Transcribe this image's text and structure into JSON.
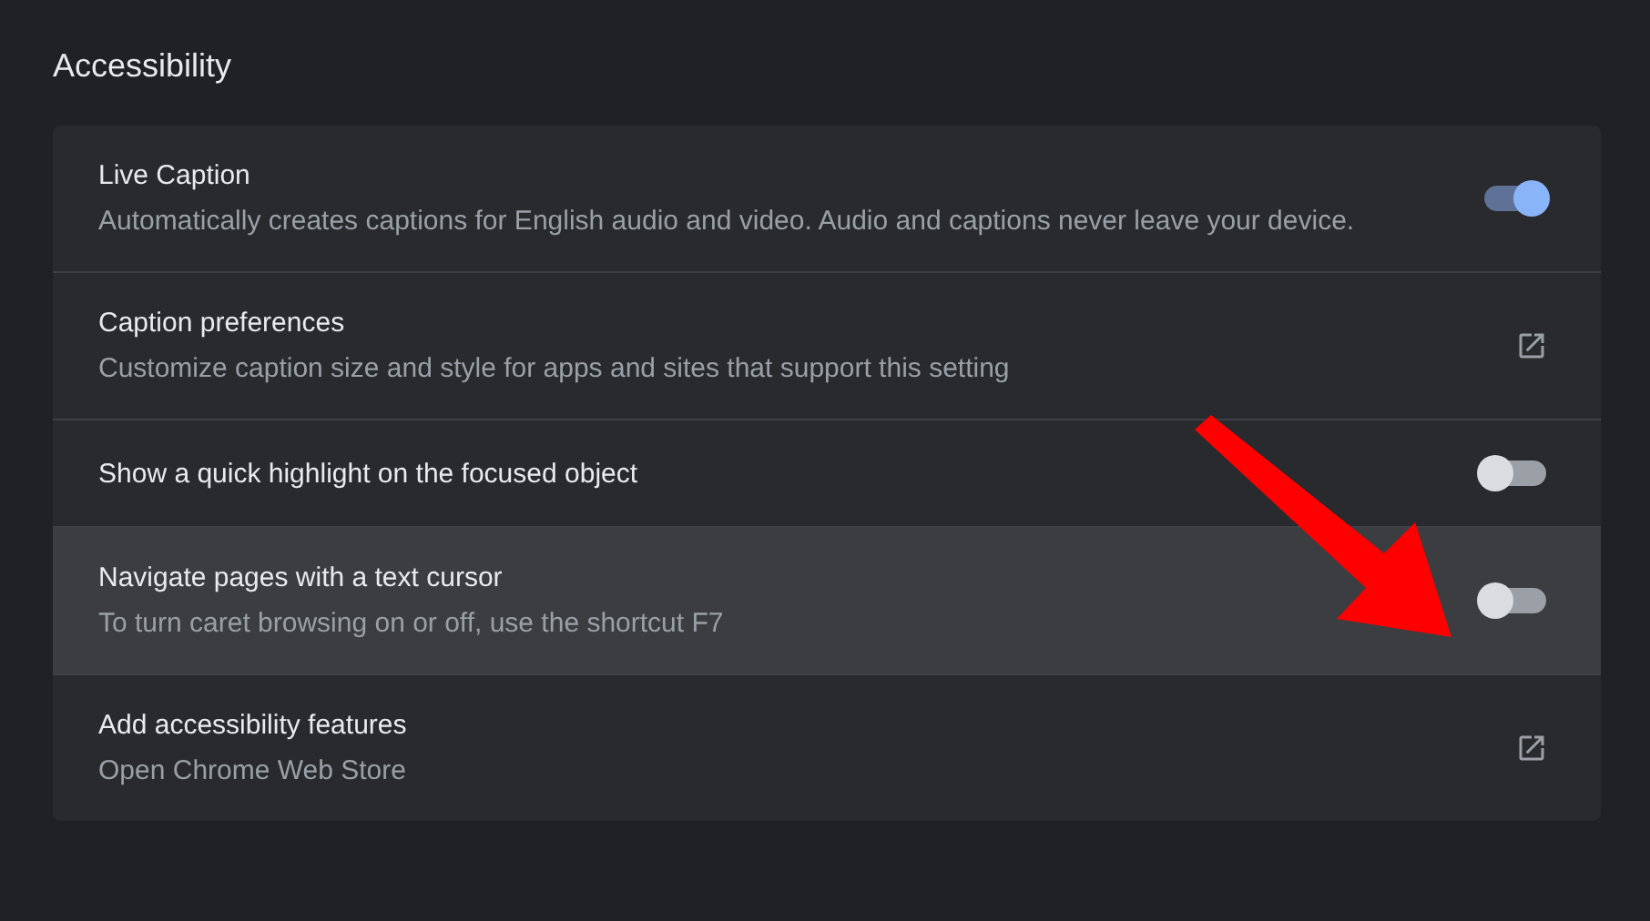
{
  "section": {
    "title": "Accessibility"
  },
  "rows": [
    {
      "kind": "toggle",
      "title": "Live Caption",
      "description": "Automatically creates captions for English audio and video. Audio and captions never leave your device.",
      "on": true,
      "highlighted": false
    },
    {
      "kind": "link",
      "title": "Caption preferences",
      "description": "Customize caption size and style for apps and sites that support this setting",
      "highlighted": false
    },
    {
      "kind": "toggle",
      "title": "Show a quick highlight on the focused object",
      "on": false,
      "highlighted": false
    },
    {
      "kind": "toggle",
      "title": "Navigate pages with a text cursor",
      "description": "To turn caret browsing on or off, use the shortcut F7",
      "on": false,
      "highlighted": true
    },
    {
      "kind": "link",
      "title": "Add accessibility features",
      "description": "Open Chrome Web Store",
      "highlighted": false
    }
  ]
}
